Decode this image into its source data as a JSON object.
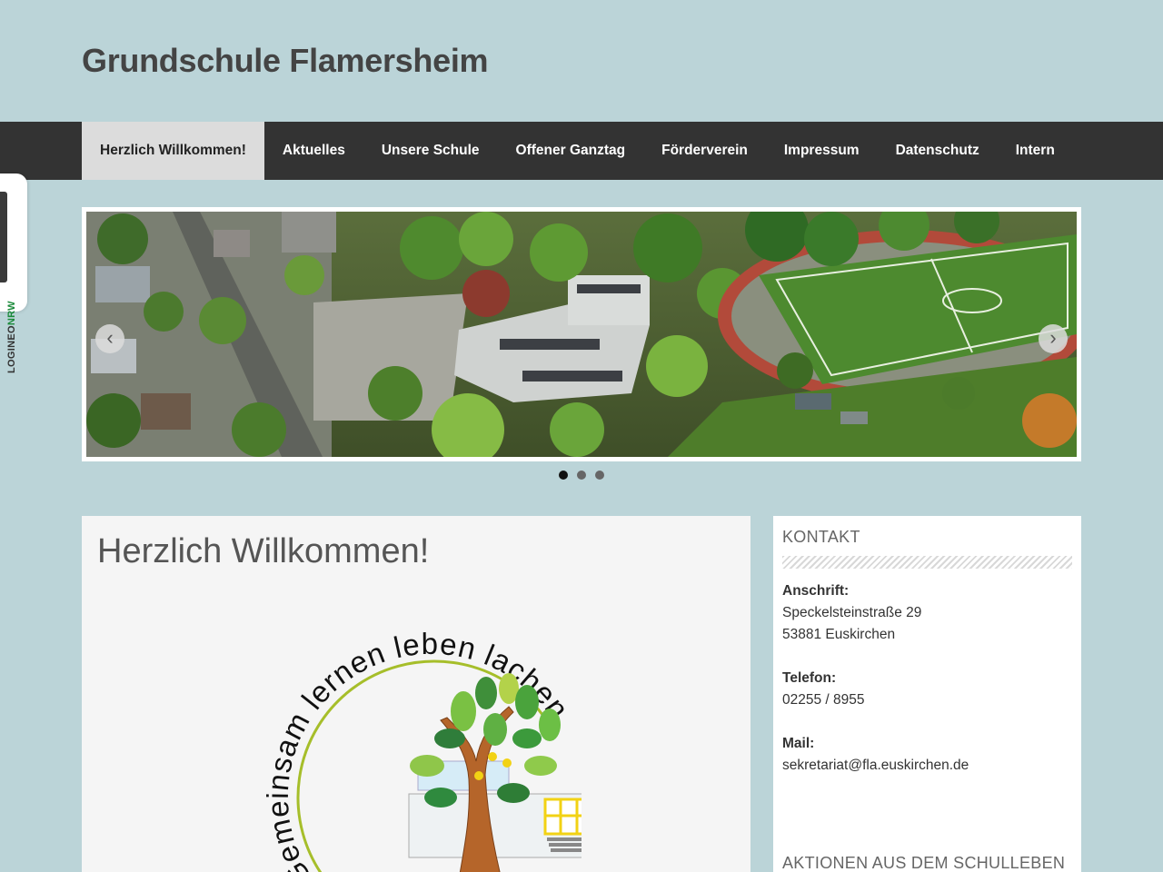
{
  "site": {
    "title": "Grundschule Flamersheim"
  },
  "nav": {
    "items": [
      {
        "label": "Herzlich Willkommen!",
        "active": true
      },
      {
        "label": "Aktuelles"
      },
      {
        "label": "Unsere Schule"
      },
      {
        "label": "Offener Ganztag"
      },
      {
        "label": "Förderverein"
      },
      {
        "label": "Impressum"
      },
      {
        "label": "Datenschutz"
      },
      {
        "label": "Intern"
      }
    ]
  },
  "logineo": {
    "prefix": "LOGINEO",
    "suffix": "NRW"
  },
  "slider": {
    "slide_count": 3,
    "active_slide": 1,
    "prev_icon": "chevron-left-icon",
    "next_icon": "chevron-right-icon"
  },
  "main": {
    "title": "Herzlich Willkommen!",
    "logo_text": "Gemeinsam lernen leben lachen"
  },
  "sidebar": {
    "widget1_title": "KONTAKT",
    "address_label": "Anschrift:",
    "address_line1": "Speckelsteinstraße 29",
    "address_line2": "53881 Euskirchen",
    "phone_label": "Telefon:",
    "phone": "02255 / 8955",
    "mail_label": "Mail:",
    "mail": "sekretariat@fla.euskirchen.de",
    "widget2_title": "AKTIONEN AUS DEM SCHULLEBEN"
  },
  "colors": {
    "background": "#bbd4d8",
    "nav": "#333333",
    "nav_active": "#dcdcdc"
  }
}
